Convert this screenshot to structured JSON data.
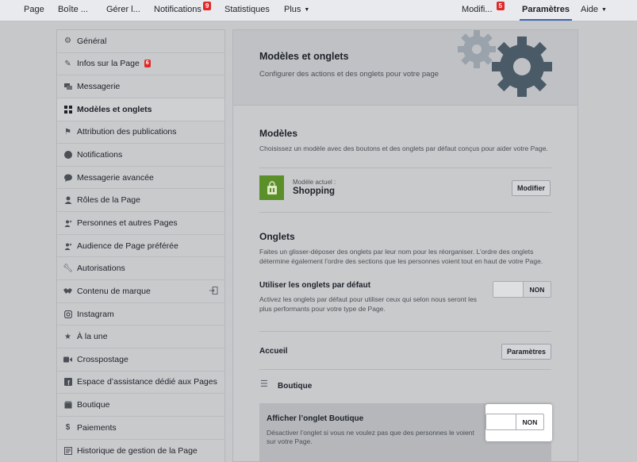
{
  "topnav": {
    "items": [
      {
        "label": "Page"
      },
      {
        "label": "Boîte ..."
      },
      {
        "label": "Gérer l..."
      },
      {
        "label": "Notifications",
        "badge": "9"
      },
      {
        "label": "Statistiques"
      },
      {
        "label": "Plus"
      },
      {
        "label": "Modifi...",
        "badge": "5"
      },
      {
        "label": "Paramètres"
      },
      {
        "label": "Aide"
      }
    ]
  },
  "sidebar": {
    "items": [
      {
        "label": "Général",
        "icon": "gear-icon"
      },
      {
        "label": "Infos sur la Page",
        "icon": "pencil-icon",
        "badge": "6"
      },
      {
        "label": "Messagerie",
        "icon": "chat-icon"
      },
      {
        "label": "Modèles et onglets",
        "icon": "grid-icon"
      },
      {
        "label": "Attribution des publications",
        "icon": "flag-icon"
      },
      {
        "label": "Notifications",
        "icon": "globe-icon"
      },
      {
        "label": "Messagerie avancée",
        "icon": "speech-bubble-icon"
      },
      {
        "label": "Rôles de la Page",
        "icon": "person-icon"
      },
      {
        "label": "Personnes et autres Pages",
        "icon": "people-icon"
      },
      {
        "label": "Audience de Page préférée",
        "icon": "audience-icon"
      },
      {
        "label": "Autorisations",
        "icon": "wrench-icon"
      },
      {
        "label": "Contenu de marque",
        "icon": "handshake-icon"
      },
      {
        "label": "Instagram",
        "icon": "instagram-icon"
      },
      {
        "label": "À la une",
        "icon": "star-icon"
      },
      {
        "label": "Crosspostage",
        "icon": "video-icon"
      },
      {
        "label": "Espace d’assistance dédié aux Pages",
        "icon": "facebook-icon"
      },
      {
        "label": "Boutique",
        "icon": "shop-icon"
      },
      {
        "label": "Paiements",
        "icon": "dollar-icon"
      },
      {
        "label": "Historique de gestion de la Page",
        "icon": "history-icon"
      }
    ]
  },
  "main": {
    "title": "Modèles et onglets",
    "subtitle": "Configurer des actions et des onglets pour votre page",
    "models": {
      "title": "Modèles",
      "description": "Choisissez un modèle avec des boutons et des onglets par défaut conçus pour aider votre Page.",
      "current_label": "Modèle actuel :",
      "current_value": "Shopping",
      "modify_button": "Modifier"
    },
    "tabs": {
      "title": "Onglets",
      "description_1": "Faites un glisser-déposer des onglets par leur nom pour les réorganiser. L’ordre des onglets",
      "description_2": "détermine également l’ordre des sections que les personnes voient tout en haut de votre Page.",
      "default_title": "Utiliser les onglets par défaut",
      "default_desc_1": "Activez les onglets par défaut pour utiliser ceux qui selon nous seront les",
      "default_desc_2": "plus performants pour votre type de Page.",
      "default_toggle": "NON",
      "home_label": "Accueil",
      "home_button": "Paramètres",
      "shop_label": "Boutique",
      "shop_show_title": "Afficher l’onglet Boutique",
      "shop_show_desc_1": "Désactiver l’onglet si vous ne voulez pas que des personnes le voient",
      "shop_show_desc_2": "sur votre Page.",
      "shop_toggle": "NON"
    }
  },
  "colors": {
    "accent": "#4267b2",
    "badge": "#e02929",
    "template_green": "#5a8f2a",
    "gear_dark": "#4a5a67",
    "gear_light": "#9aa3ab"
  }
}
